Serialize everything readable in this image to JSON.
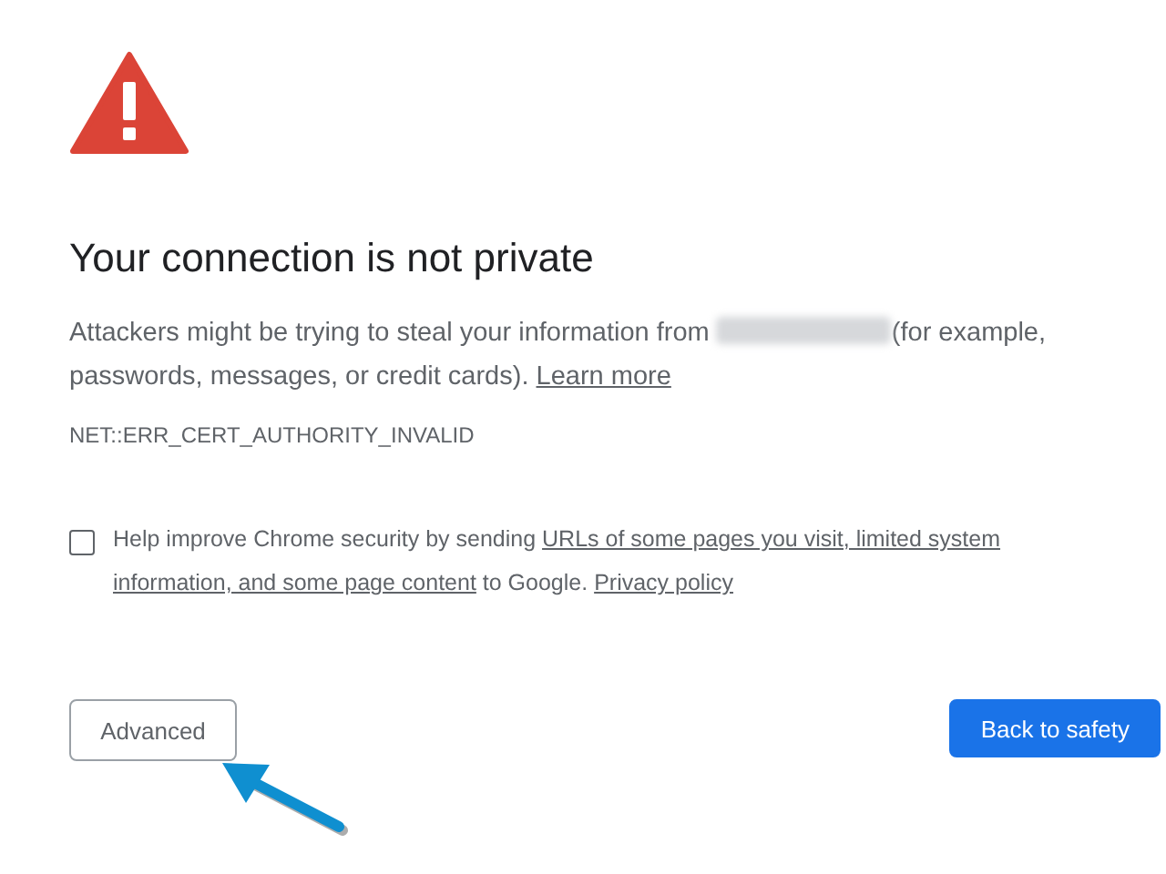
{
  "heading": "Your connection is not private",
  "message": {
    "before": "Attackers might be trying to steal your information from ",
    "address_blurred": true,
    "after": "(for example, passwords, messages, or credit cards). ",
    "link": "Learn more"
  },
  "error_code": "NET::ERR_CERT_AUTHORITY_INVALID",
  "opt_in": {
    "checked": false,
    "parts": [
      {
        "text": "Help improve Chrome security by sending ",
        "link": false
      },
      {
        "text": "URLs of some pages you visit, limited system",
        "link": true
      },
      {
        "text": "information, and some page content",
        "link": true
      },
      {
        "text": " to Google. ",
        "link": false
      },
      {
        "text": "Privacy policy",
        "link": true
      }
    ]
  },
  "buttons": [
    {
      "label": "Advanced",
      "kind": "secondary"
    },
    {
      "label": "Back to safety",
      "kind": "primary"
    }
  ]
}
